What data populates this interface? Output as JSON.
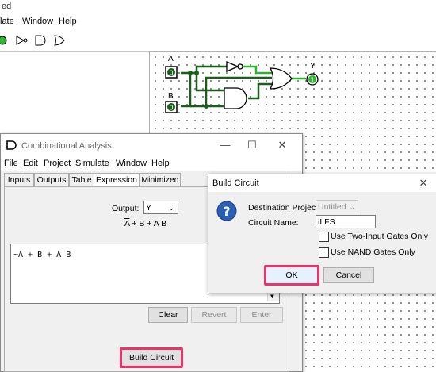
{
  "main": {
    "title_fragment": "ed",
    "menu": [
      "late",
      "Window",
      "Help"
    ]
  },
  "circuit": {
    "input_a_label": "A",
    "input_b_label": "B",
    "output_label": "Y",
    "input_a_value": "0",
    "input_b_value": "0",
    "output_value": "1"
  },
  "analysis": {
    "title": "Combinational Analysis",
    "menu": [
      "File",
      "Edit",
      "Project",
      "Simulate",
      "Window",
      "Help"
    ],
    "tabs": [
      "Inputs",
      "Outputs",
      "Table",
      "Expression",
      "Minimized"
    ],
    "active_tab": "Expression",
    "output_label": "Output:",
    "output_value": "Y",
    "formula_display": "A + B + A B",
    "expression_text": "~A + B + A B",
    "clear_label": "Clear",
    "revert_label": "Revert",
    "enter_label": "Enter",
    "build_label": "Build Circuit"
  },
  "dialog": {
    "title": "Build Circuit",
    "dest_label": "Destination Project:",
    "dest_value": "Untitled",
    "name_label": "Circuit Name:",
    "name_value": "iLFS",
    "two_input_label": "Use Two-Input Gates Only",
    "nand_label": "Use NAND Gates Only",
    "ok_label": "OK",
    "cancel_label": "Cancel"
  },
  "colors": {
    "highlight": "#e8336b",
    "wire_on": "#2db52d",
    "wire_off": "#1a5e1a"
  },
  "icons": [
    "question-icon",
    "logisim-logo-icon",
    "chevron-down-icon",
    "close-icon",
    "minimize-icon",
    "maximize-icon"
  ]
}
